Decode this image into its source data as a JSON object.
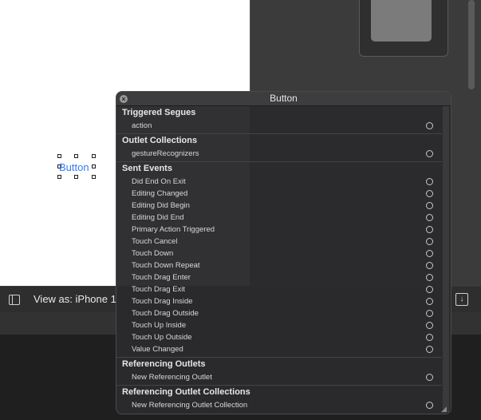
{
  "canvas": {
    "button_label": "Button"
  },
  "bottom_bar": {
    "view_as": "View as: iPhone 1"
  },
  "popup": {
    "title": "Button",
    "sections": [
      {
        "title": "Triggered Segues",
        "items": [
          "action"
        ]
      },
      {
        "title": "Outlet Collections",
        "items": [
          "gestureRecognizers"
        ]
      },
      {
        "title": "Sent Events",
        "items": [
          "Did End On Exit",
          "Editing Changed",
          "Editing Did Begin",
          "Editing Did End",
          "Primary Action Triggered",
          "Touch Cancel",
          "Touch Down",
          "Touch Down Repeat",
          "Touch Drag Enter",
          "Touch Drag Exit",
          "Touch Drag Inside",
          "Touch Drag Outside",
          "Touch Up Inside",
          "Touch Up Outside",
          "Value Changed"
        ]
      },
      {
        "title": "Referencing Outlets",
        "items": [
          "New Referencing Outlet"
        ]
      },
      {
        "title": "Referencing Outlet Collections",
        "items": [
          "New Referencing Outlet Collection"
        ]
      }
    ]
  }
}
